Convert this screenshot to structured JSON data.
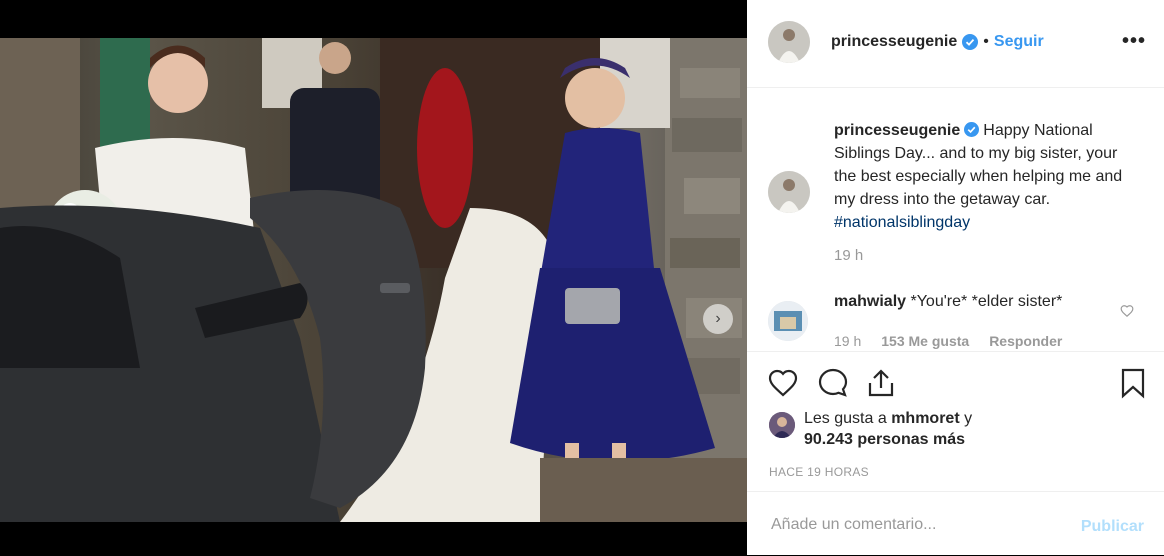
{
  "post": {
    "carousel_dots": 2,
    "active_dot": 0
  },
  "header": {
    "username": "princesseugenie",
    "follow_label": "Seguir",
    "separator": "•",
    "more_label": "•••"
  },
  "caption": {
    "username": "princesseugenie",
    "text": "Happy National Siblings Day... and to my big sister, your the best especially when helping me and my dress into the getaway car.",
    "hashtag": "#nationalsiblingday",
    "time": "19 h"
  },
  "comment": {
    "username": "mahwialy",
    "text": "*You're* *elder sister*",
    "time": "19 h",
    "likes": "153 Me gusta",
    "reply": "Responder"
  },
  "likes": {
    "prefix": "Les gusta a",
    "user": "mhmoret",
    "connector": "y",
    "count": "90.243 personas más"
  },
  "posted_time": "HACE 19 HORAS",
  "add_comment": {
    "placeholder": "Añade un comentario...",
    "publish_label": "Publicar"
  },
  "colors": {
    "link_blue": "#3897f0",
    "publish_disabled": "#b2dffc",
    "verified_blue": "#3897f0",
    "hashtag": "#003569"
  }
}
